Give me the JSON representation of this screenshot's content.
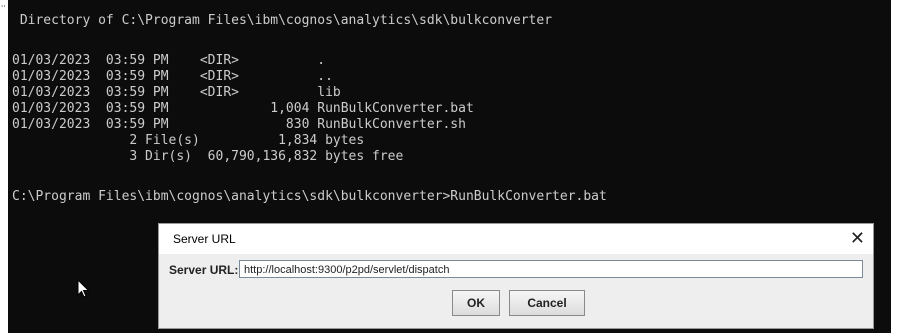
{
  "console": {
    "lines": [
      " Directory of C:\\Program Files\\ibm\\cognos\\analytics\\sdk\\bulkconverter",
      "",
      "01/03/2023  03:59 PM    <DIR>          .",
      "01/03/2023  03:59 PM    <DIR>          ..",
      "01/03/2023  03:59 PM    <DIR>          lib",
      "01/03/2023  03:59 PM             1,004 RunBulkConverter.bat",
      "01/03/2023  03:59 PM               830 RunBulkConverter.sh",
      "               2 File(s)          1,834 bytes",
      "               3 Dir(s)  60,790,136,832 bytes free",
      "",
      "C:\\Program Files\\ibm\\cognos\\analytics\\sdk\\bulkconverter>RunBulkConverter.bat"
    ],
    "text_color": "#cccccc",
    "background": "#0c0c0c"
  },
  "dialog": {
    "title": "Server URL",
    "field_label": "Server URL:",
    "url_value": "http://localhost:9300/p2pd/servlet/dispatch",
    "ok_label": "OK",
    "cancel_label": "Cancel",
    "close_icon": "close-icon"
  },
  "cursor_icon": "mouse-pointer-icon"
}
